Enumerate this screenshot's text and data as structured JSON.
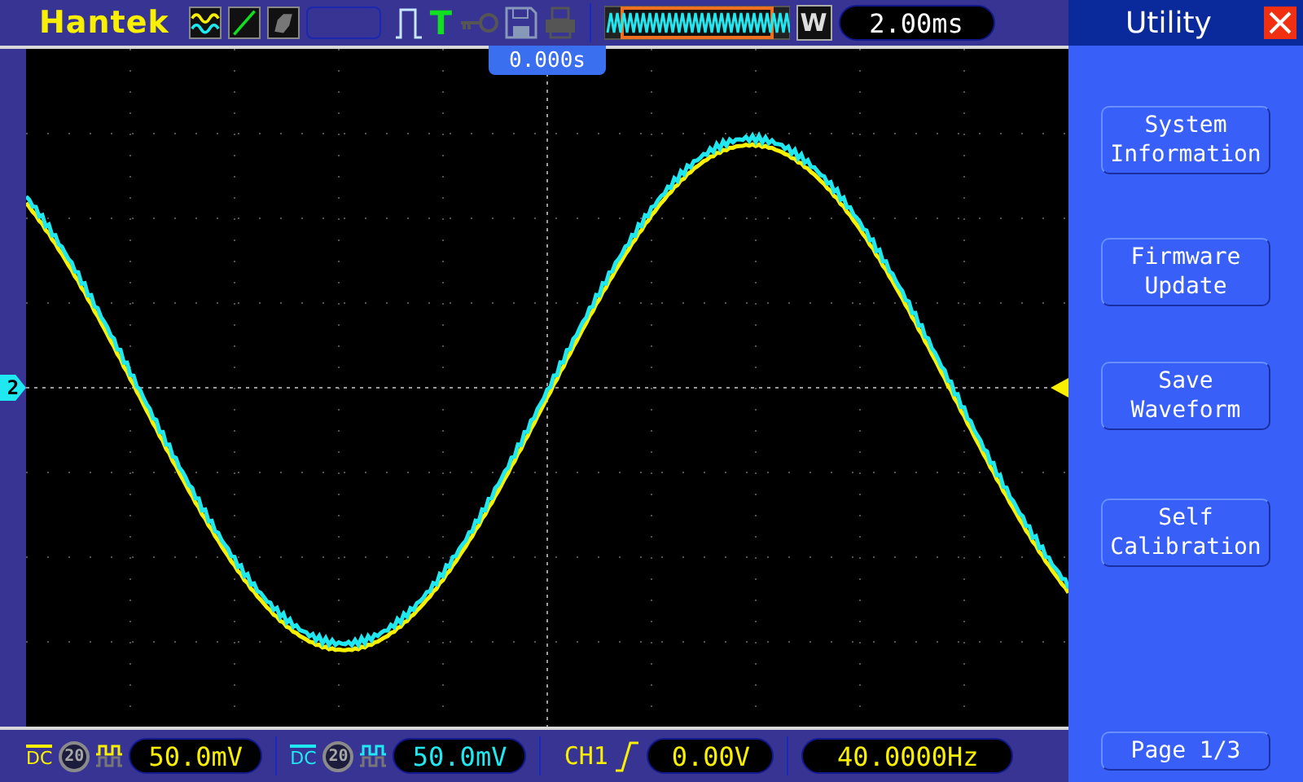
{
  "top_bar": {
    "brand": "Hantek",
    "trigger_type": "T",
    "window_mark": "W",
    "timebase": "2.00ms"
  },
  "screen": {
    "trigger_position": "0.000s",
    "channel_marker": "2"
  },
  "channels": [
    {
      "coupling": "DC",
      "bw_limit": "20",
      "bw_limit_on": false,
      "scale": "50.0mV",
      "color": "#f8f000"
    },
    {
      "coupling": "DC",
      "bw_limit": "20",
      "bw_limit_on": false,
      "scale": "50.0mV",
      "color": "#20e8f0"
    }
  ],
  "trigger": {
    "source": "CH1",
    "level": "0.00V",
    "frequency": "40.0000Hz"
  },
  "menu": {
    "title": "Utility",
    "buttons": [
      "System Information",
      "Firmware Update",
      "Save Waveform",
      "Self Calibration"
    ],
    "page": "Page 1/3"
  }
}
